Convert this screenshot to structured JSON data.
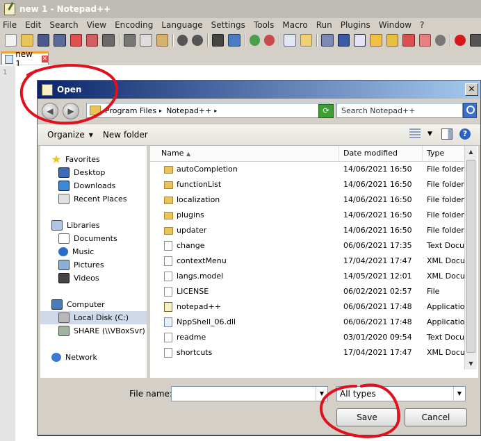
{
  "app": {
    "title": "new 1 - Notepad++",
    "menu": [
      "File",
      "Edit",
      "Search",
      "View",
      "Encoding",
      "Language",
      "Settings",
      "Tools",
      "Macro",
      "Run",
      "Plugins",
      "Window",
      "?"
    ],
    "tab_label": "new 1",
    "line_number": "1"
  },
  "dialog": {
    "title": "Open",
    "close_label": "✕",
    "breadcrumb": [
      "Program Files",
      "Notepad++"
    ],
    "search_placeholder": "Search Notepad++",
    "organize_label": "Organize",
    "new_folder_label": "New folder",
    "help_label": "?",
    "nav": {
      "favorites": "Favorites",
      "desktop": "Desktop",
      "downloads": "Downloads",
      "recent_places": "Recent Places",
      "libraries": "Libraries",
      "documents": "Documents",
      "music": "Music",
      "pictures": "Pictures",
      "videos": "Videos",
      "computer": "Computer",
      "local_disk": "Local Disk (C:)",
      "share": "SHARE (\\\\VBoxSvr) (Z",
      "network": "Network"
    },
    "columns": {
      "name": "Name",
      "date_modified": "Date modified",
      "type": "Type"
    },
    "files": [
      {
        "name": "autoCompletion",
        "date": "14/06/2021 16:50",
        "type": "File folder",
        "icon": "folder"
      },
      {
        "name": "functionList",
        "date": "14/06/2021 16:50",
        "type": "File folder",
        "icon": "folder"
      },
      {
        "name": "localization",
        "date": "14/06/2021 16:50",
        "type": "File folder",
        "icon": "folder"
      },
      {
        "name": "plugins",
        "date": "14/06/2021 16:50",
        "type": "File folder",
        "icon": "folder"
      },
      {
        "name": "updater",
        "date": "14/06/2021 16:50",
        "type": "File folder",
        "icon": "folder"
      },
      {
        "name": "change",
        "date": "06/06/2021 17:35",
        "type": "Text Docume",
        "icon": "doc"
      },
      {
        "name": "contextMenu",
        "date": "17/04/2021 17:47",
        "type": "XML Docume",
        "icon": "doc"
      },
      {
        "name": "langs.model",
        "date": "14/05/2021 12:01",
        "type": "XML Docume",
        "icon": "doc"
      },
      {
        "name": "LICENSE",
        "date": "06/02/2021 02:57",
        "type": "File",
        "icon": "doc"
      },
      {
        "name": "notepad++",
        "date": "06/06/2021 17:48",
        "type": "Application",
        "icon": "app"
      },
      {
        "name": "NppShell_06.dll",
        "date": "06/06/2021 17:48",
        "type": "Application e",
        "icon": "dll"
      },
      {
        "name": "readme",
        "date": "03/01/2020 09:54",
        "type": "Text Docume",
        "icon": "doc"
      },
      {
        "name": "shortcuts",
        "date": "17/04/2021 17:47",
        "type": "XML Docume",
        "icon": "doc"
      }
    ],
    "file_name_label": "File name:",
    "file_name_value": "",
    "file_type_value": "All types",
    "save_label": "Save",
    "cancel_label": "Cancel"
  },
  "colors": {
    "dialog_title_start": "#0a246a",
    "dialog_title_end": "#a6caf0",
    "selected_nav": "#cfd9ea",
    "annotation": "#e0101c"
  }
}
